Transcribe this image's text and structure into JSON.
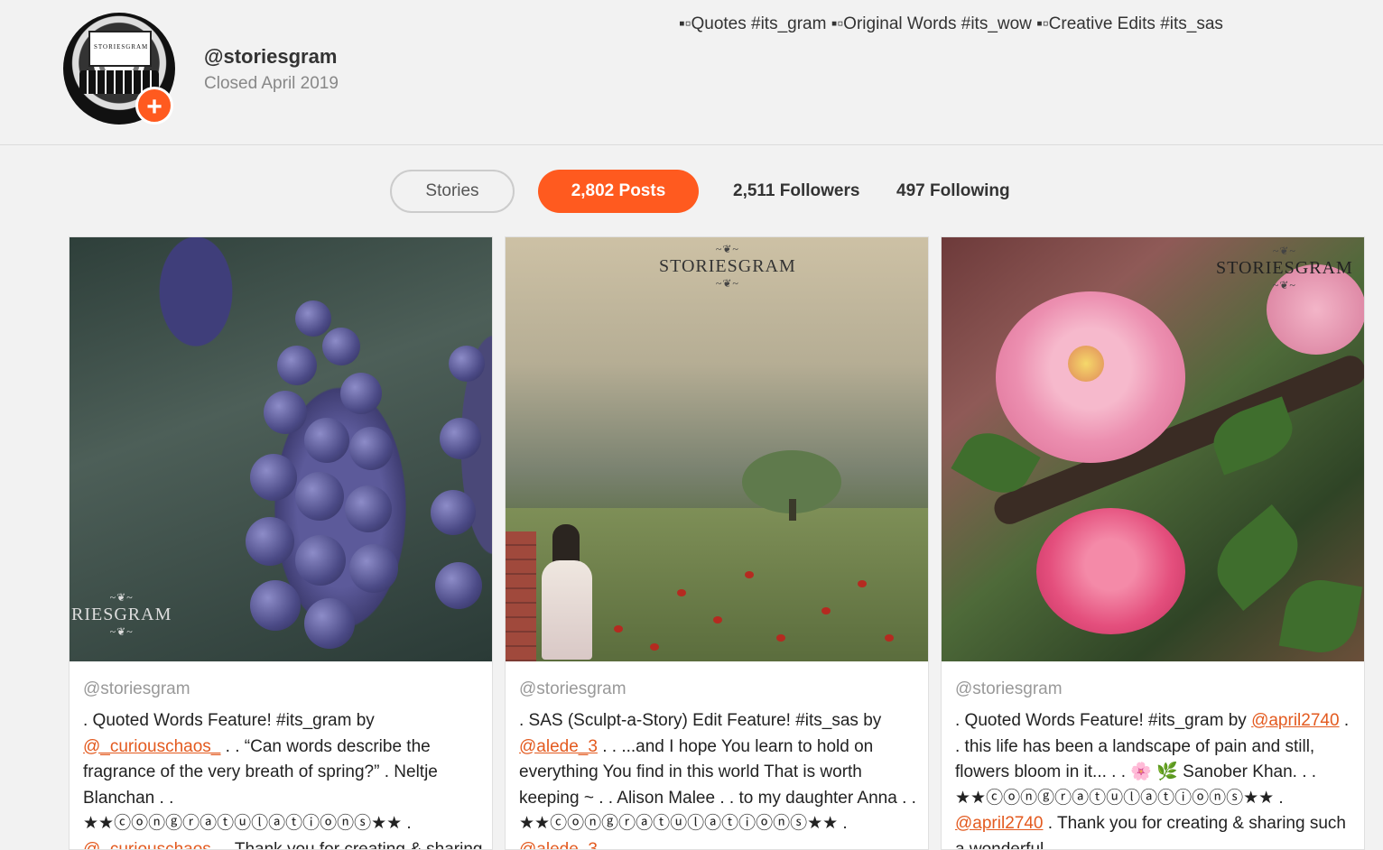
{
  "profile": {
    "handle": "@storiesgram",
    "status": "Closed April 2019",
    "avatar_text": "STORIESGRAM",
    "follow_icon": "plus-icon",
    "bio": "▪▫Quotes #its_gram ▪▫Original Words #its_wow ▪▫Creative Edits #its_sas"
  },
  "tabs": {
    "stories": "Stories",
    "posts": "2,802 Posts",
    "followers": "2,511 Followers",
    "following": "497 Following"
  },
  "colors": {
    "accent": "#ff5a1f",
    "mention": "#e35a1f"
  },
  "posts": [
    {
      "watermark": "RIESGRAM",
      "user": "@storiesgram",
      "t1": ". Quoted Words Feature! #its_gram by ",
      "m1": "@_curiouschaos_",
      "t2": " . . “Can words describe the fragrance of the very breath of spring?” . Neltje Blanchan . . ★★ⓒⓞⓝⓖⓡⓐⓣⓤⓛⓐⓣⓘⓞⓝⓢ★★ . ",
      "m2": "@_curiouschaos_",
      "t3": " . Thank you for creating & sharing"
    },
    {
      "watermark": "STORIESGRAM",
      "user": "@storiesgram",
      "t1": ". SAS (Sculpt-a-Story) Edit Feature! #its_sas by ",
      "m1": "@alede_3",
      "t2": " . . ...and I hope You learn to hold on everything You find in this world That is worth keeping ~ . . Alison Malee . . to my daughter Anna . . ★★ⓒⓞⓝⓖⓡⓐⓣⓤⓛⓐⓣⓘⓞⓝⓢ★★ . ",
      "m2": "@alede_3",
      "t3": " ."
    },
    {
      "watermark": "STORIESGRAM",
      "user": "@storiesgram",
      "t1": ". Quoted Words Feature! #its_gram by ",
      "m1": "@april2740",
      "t2": " . . this life has been a landscape of pain and still, flowers bloom in it... . . 🌸 🌿 Sanober Khan. . . ★★ⓒⓞⓝⓖⓡⓐⓣⓤⓛⓐⓣⓘⓞⓝⓢ★★ . ",
      "m2": "@april2740",
      "t3": " . Thank you for creating & sharing such a wonderful"
    }
  ]
}
